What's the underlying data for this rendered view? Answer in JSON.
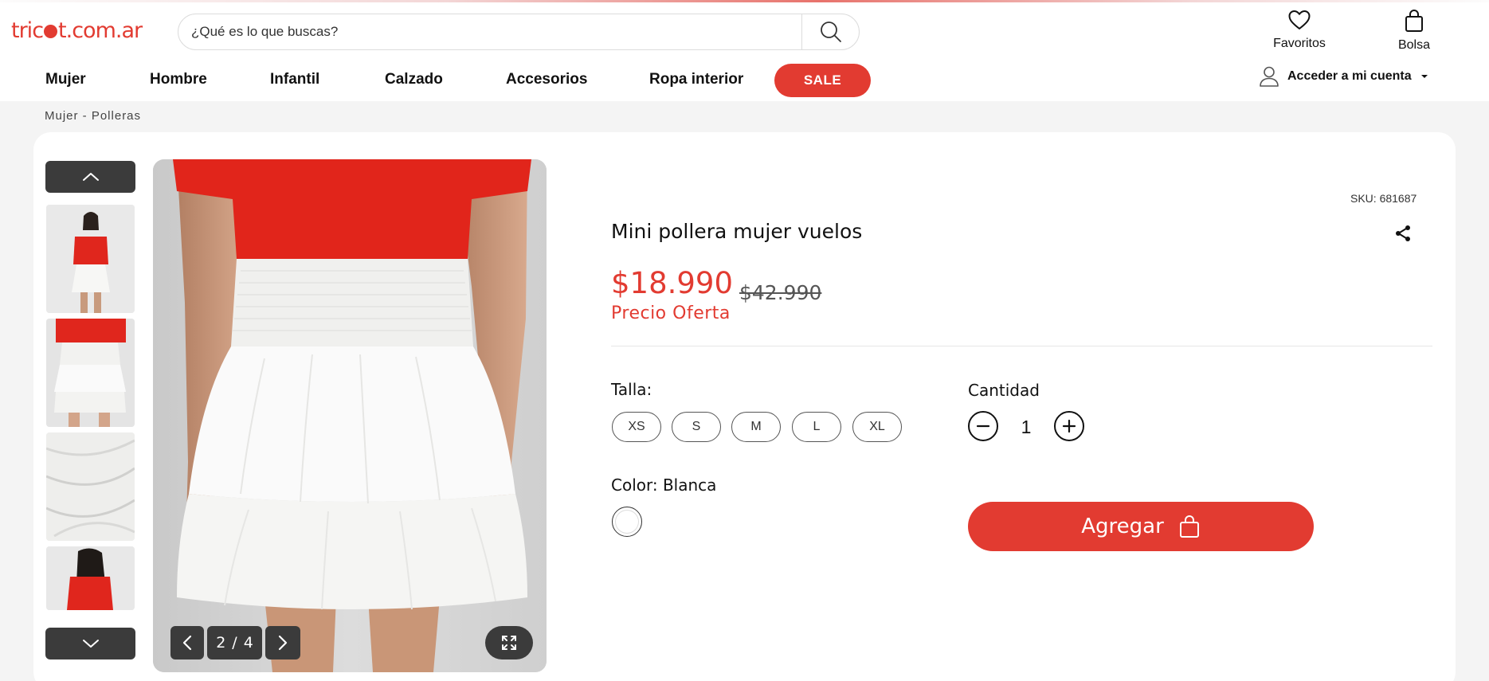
{
  "header": {
    "logo": {
      "before": "tric",
      "after": "t.com.ar"
    },
    "search": {
      "placeholder": "¿Qué es lo que buscas?"
    },
    "favorites_label": "Favoritos",
    "bag_label": "Bolsa"
  },
  "nav": {
    "items": [
      "Mujer",
      "Hombre",
      "Infantil",
      "Calzado",
      "Accesorios",
      "Ropa interior"
    ],
    "sale_label": "SALE",
    "account_label": "Acceder a mi cuenta"
  },
  "breadcrumb": "Mujer - Polleras",
  "gallery": {
    "thumbnail_count": 4,
    "current_index": "2",
    "total": "4",
    "separator": "/"
  },
  "product": {
    "sku": "SKU: 681687",
    "title": "Mini pollera mujer vuelos",
    "price": "$18.990",
    "old_price": "$42.990",
    "price_label": "Precio Oferta",
    "size_label": "Talla:",
    "sizes": [
      "XS",
      "S",
      "M",
      "L",
      "XL"
    ],
    "quantity_label": "Cantidad",
    "quantity": "1",
    "color_label": "Color: Blanca",
    "color_swatch": "#ffffff",
    "add_button": "Agregar"
  },
  "colors": {
    "accent": "#e23b31",
    "dark_control": "#3b3b3b"
  }
}
